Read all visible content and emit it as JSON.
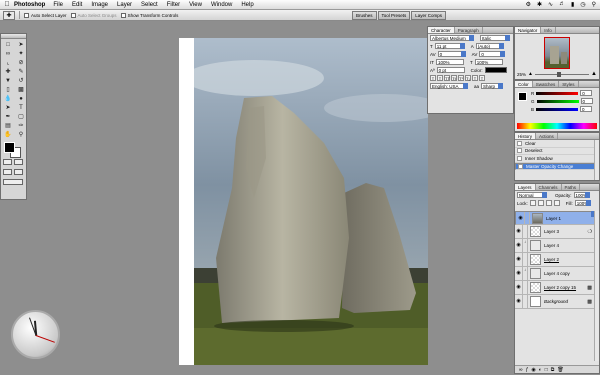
{
  "menubar": {
    "app": "Photoshop",
    "items": [
      "File",
      "Edit",
      "Image",
      "Layer",
      "Select",
      "Filter",
      "View",
      "Window",
      "Help"
    ]
  },
  "options": {
    "auto_select_layer": "Auto Select Layer",
    "auto_select_groups": "Auto Select Groups",
    "show_transform": "Show Transform Controls",
    "well_tabs": [
      "Brushes",
      "Tool Presets",
      "Layer Comps"
    ]
  },
  "character": {
    "tabs": [
      "Character",
      "Paragraph"
    ],
    "font_family": "Albertus Medium",
    "font_style": "Italic",
    "size": "11 pt",
    "leading": "(Auto)",
    "kerning": "0",
    "tracking": "0",
    "vscale": "100%",
    "hscale": "100%",
    "baseline": "0 pt",
    "color_label": "Color:",
    "format_buttons": [
      "T",
      "T",
      "TT",
      "Tt",
      "T¹",
      "T₁",
      "T",
      "T"
    ],
    "language": "English: USA",
    "antialias": "Sharp"
  },
  "navigator": {
    "tabs": [
      "Navigator",
      "Info"
    ],
    "zoom": "25%"
  },
  "color_panel": {
    "tabs": [
      "Color",
      "Swatches",
      "Styles"
    ],
    "channels": [
      {
        "label": "R",
        "value": "0"
      },
      {
        "label": "G",
        "value": "0"
      },
      {
        "label": "B",
        "value": "0"
      }
    ]
  },
  "history": {
    "tabs": [
      "History",
      "Actions"
    ],
    "items": [
      "Clear",
      "Deselect",
      "Inner Shadow",
      "Master Opacity Change"
    ],
    "selected_index": 3
  },
  "layers": {
    "tabs": [
      "Layers",
      "Channels",
      "Paths"
    ],
    "blend_mode": "Normal",
    "opacity_label": "Opacity:",
    "opacity": "100%",
    "lock_label": "Lock:",
    "fill_label": "Fill:",
    "fill": "100%",
    "items": [
      {
        "name": "Layer 1",
        "selected": true
      },
      {
        "name": "Layer 3"
      },
      {
        "name": "Layer 4"
      },
      {
        "name": "Layer 2"
      },
      {
        "name": "Layer 4 copy"
      },
      {
        "name": "Layer 2 copy 15"
      },
      {
        "name": "Background"
      }
    ]
  }
}
